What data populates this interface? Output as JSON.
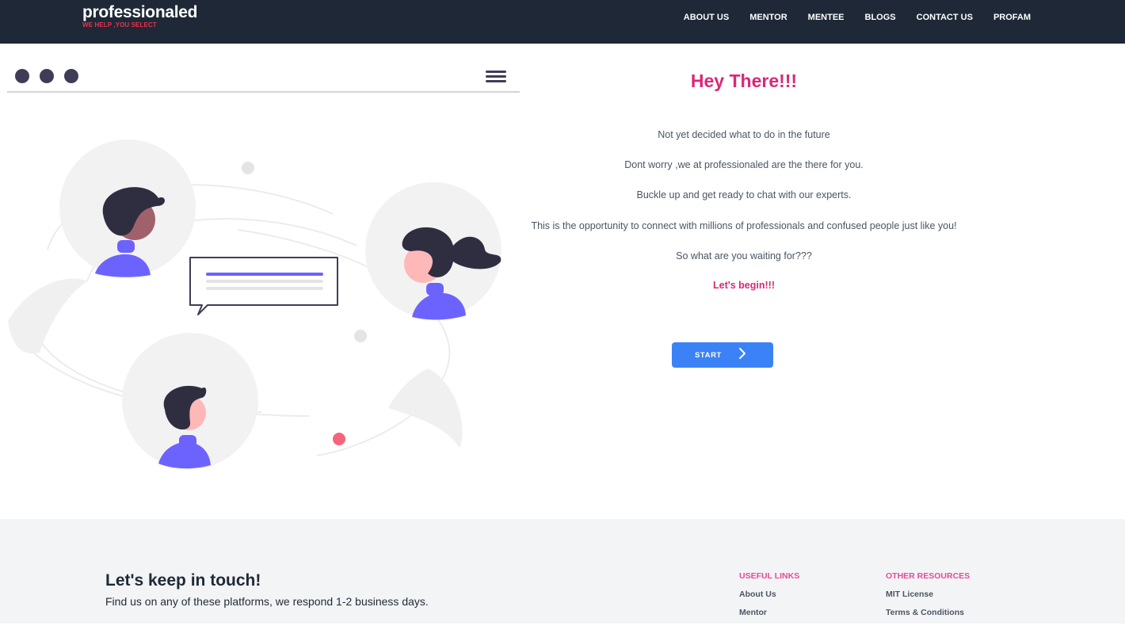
{
  "brand": {
    "name": "professionaled",
    "tagline": "WE HELP ,YOU SELECT"
  },
  "nav": {
    "items": [
      "ABOUT US",
      "MENTOR",
      "MENTEE",
      "BLOGS",
      "CONTACT US",
      "PROFAM"
    ]
  },
  "hero": {
    "title": "Hey There!!!",
    "lines": [
      "Not yet decided what to do in the future",
      "Dont worry ,we at professionaled are the there for you.",
      "Buckle up and get ready to chat with our experts.",
      "This is the opportunity to connect with millions of professionals and confused people just like you!",
      "So what are you waiting for???"
    ],
    "cta_text": "Let's begin!!!",
    "start_label": "START"
  },
  "footer": {
    "title": "Let's keep in touch!",
    "subtitle": "Find us on any of these platforms, we respond 1-2 business days.",
    "useful_links": {
      "heading": "USEFUL LINKS",
      "items": [
        "About Us",
        "Mentor"
      ]
    },
    "other_resources": {
      "heading": "OTHER RESOURCES",
      "items": [
        "MIT License",
        "Terms & Conditions"
      ]
    }
  },
  "colors": {
    "nav_bg": "#1e2836",
    "accent": "#db2777",
    "button": "#3b82f6",
    "footer_bg": "#f3f4f6"
  },
  "icons": [
    "menu-icon",
    "chevron-right-icon",
    "window-dot-icon"
  ]
}
